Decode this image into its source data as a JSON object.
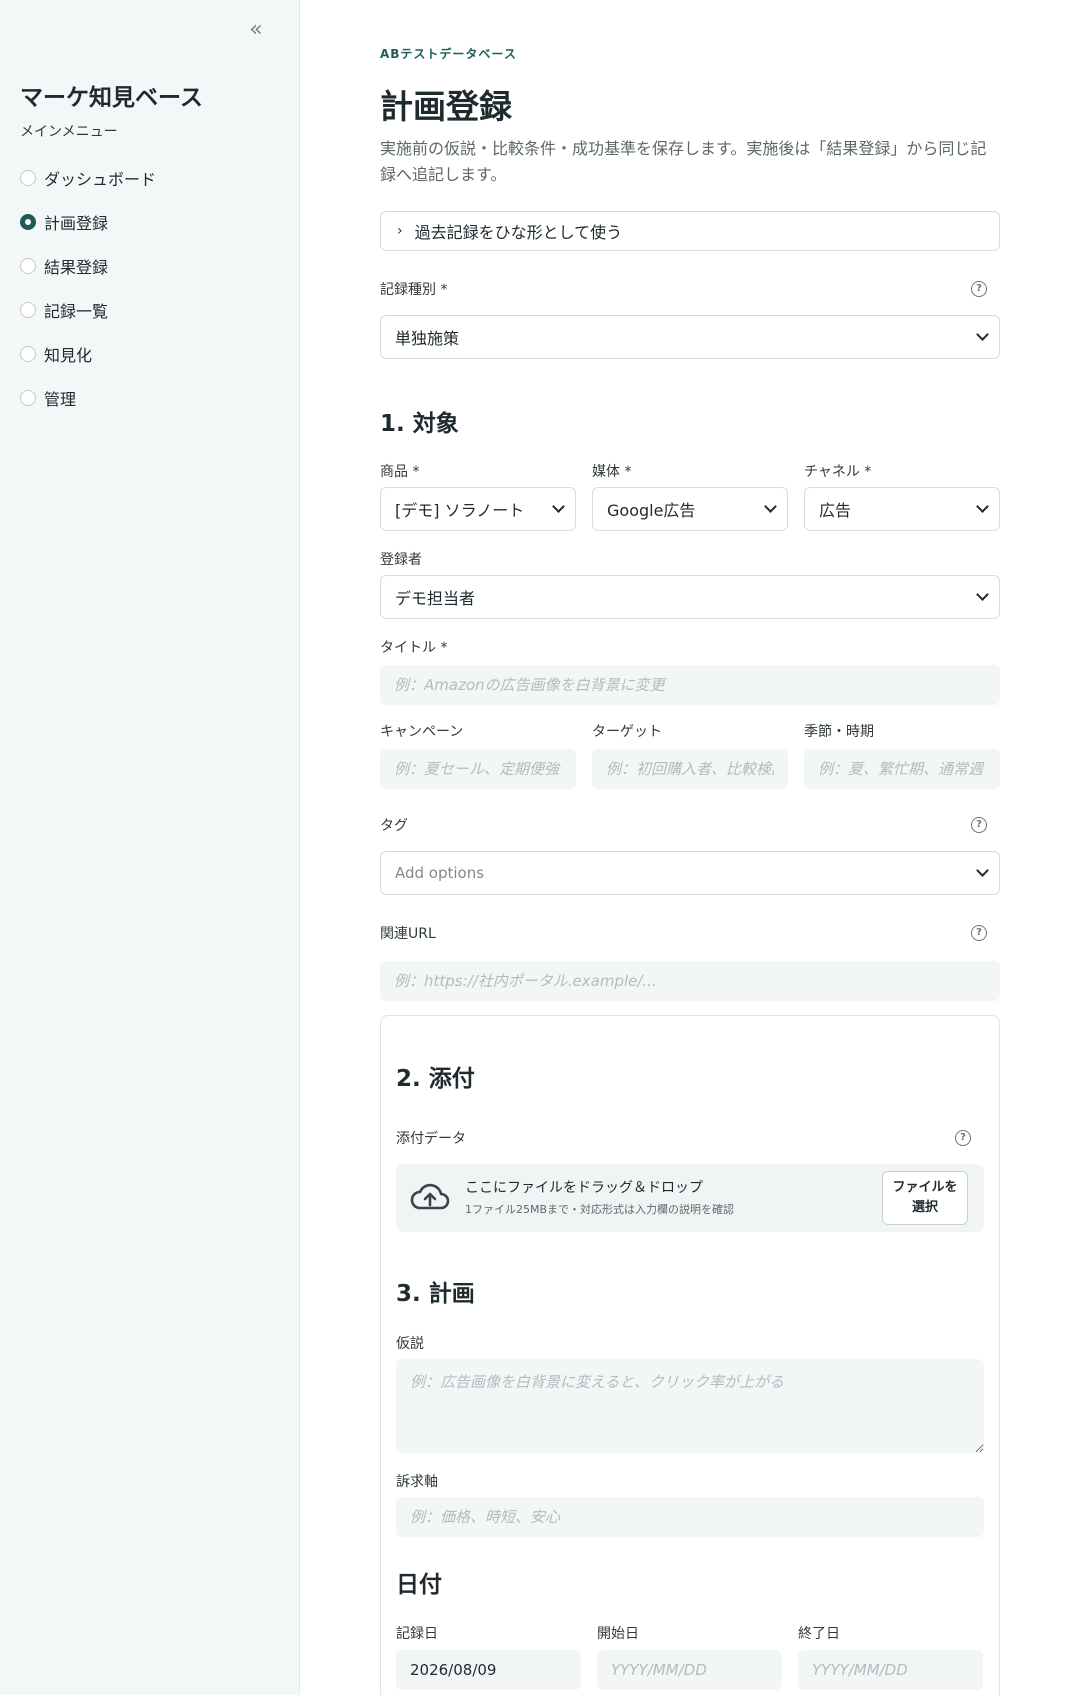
{
  "sidebar": {
    "collapse_label": "«",
    "app_title": "マーケ知見ベース",
    "menu_caption": "メインメニュー",
    "items": [
      {
        "label": "ダッシュボード",
        "active": false
      },
      {
        "label": "計画登録",
        "active": true
      },
      {
        "label": "結果登録",
        "active": false
      },
      {
        "label": "記録一覧",
        "active": false
      },
      {
        "label": "知見化",
        "active": false
      },
      {
        "label": "管理",
        "active": false
      }
    ]
  },
  "header": {
    "eyebrow": "ABテストデータベース",
    "title": "計画登録",
    "description": "実施前の仮説・比較条件・成功基準を保存します。実施後は「結果登録」から同じ記録へ追記します。"
  },
  "template_expander": {
    "chevron": "›",
    "label": "過去記録をひな形として使う"
  },
  "record_type": {
    "label": "記録種別 *",
    "value": "単独施策"
  },
  "section1": {
    "title": "1. 対象",
    "product": {
      "label": "商品 *",
      "value": "[デモ] ソラノート"
    },
    "media": {
      "label": "媒体 *",
      "value": "Google広告"
    },
    "channel": {
      "label": "チャネル *",
      "value": "広告"
    },
    "registrant": {
      "label": "登録者",
      "value": "デモ担当者"
    },
    "title_field": {
      "label": "タイトル *",
      "placeholder": "例：Amazonの広告画像を白背景に変更"
    },
    "campaign": {
      "label": "キャンペーン",
      "placeholder": "例：夏セール、定期便強化"
    },
    "target": {
      "label": "ターゲット",
      "placeholder": "例：初回購入者、比較検討層"
    },
    "season": {
      "label": "季節・時期",
      "placeholder": "例：夏、繁忙期、通常週"
    },
    "tags": {
      "label": "タグ",
      "placeholder": "Add options"
    },
    "url": {
      "label": "関連URL",
      "placeholder": "例：https://社内ポータル.example/..."
    }
  },
  "section2": {
    "title": "2. 添付",
    "attach_label": "添付データ",
    "drop_main": "ここにファイルをドラッグ＆ドロップ",
    "drop_sub": "1ファイル25MBまで・対応形式は入力欄の説明を確認",
    "browse_line1": "ファイルを",
    "browse_line2": "選択"
  },
  "section3": {
    "title": "3. 計画",
    "hypothesis": {
      "label": "仮説",
      "placeholder": "例：広告画像を白背景に変えると、クリック率が上がる"
    },
    "appeal": {
      "label": "訴求軸",
      "placeholder": "例：価格、時短、安心"
    }
  },
  "dates": {
    "title": "日付",
    "record_date": {
      "label": "記録日",
      "value": "2026/08/09"
    },
    "start_date": {
      "label": "開始日",
      "placeholder": "YYYY/MM/DD"
    },
    "end_date": {
      "label": "終了日",
      "placeholder": "YYYY/MM/DD"
    }
  },
  "colors": {
    "accent": "#1e5c5a",
    "sidebar_bg": "#f4f7f7",
    "input_bg": "#f3f6f6"
  },
  "icons": {
    "help": "?",
    "upload": "cloud-upload-icon"
  }
}
